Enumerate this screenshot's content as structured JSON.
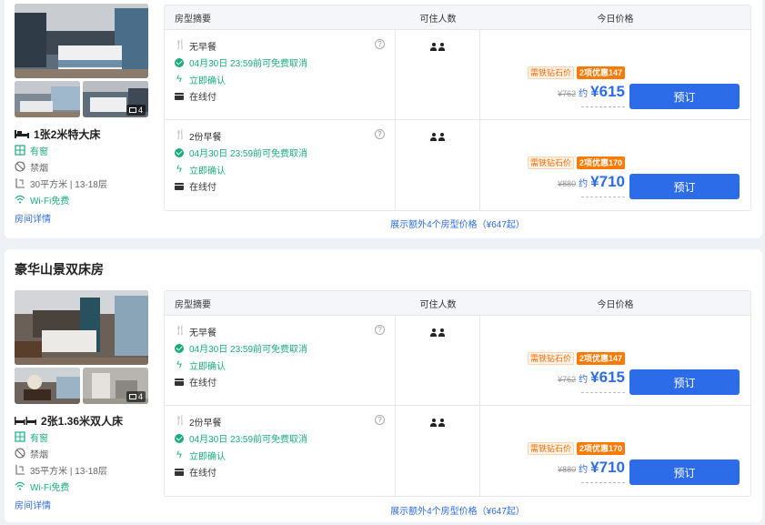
{
  "rooms": [
    {
      "title": "",
      "photo_count": "4",
      "bed": "1张2米特大床",
      "window": "有窗",
      "smoking": "禁烟",
      "area_floor": "30平方米 | 13-18层",
      "wifi": "Wi-Fi免费",
      "detail_link": "房间详情",
      "more_link": "展示额外4个房型价格（¥647起）",
      "offers": [
        {
          "meal": "无早餐",
          "cancel": "04月30日 23:59前可免费取消",
          "confirm": "立即确认",
          "pay": "在线付",
          "promo1": "需铁钻石价",
          "promo2": "2项优惠147",
          "old_price": "¥762",
          "about": "约",
          "price": "¥615",
          "book": "预订"
        },
        {
          "meal": "2份早餐",
          "cancel": "04月30日 23:59前可免费取消",
          "confirm": "立即确认",
          "pay": "在线付",
          "promo1": "需铁钻石价",
          "promo2": "2项优惠170",
          "old_price": "¥880",
          "about": "约",
          "price": "¥710",
          "book": "预订"
        }
      ]
    },
    {
      "title": "豪华山景双床房",
      "photo_count": "4",
      "bed": "2张1.36米双人床",
      "window": "有窗",
      "smoking": "禁烟",
      "area_floor": "35平方米 | 13-18层",
      "wifi": "Wi-Fi免费",
      "detail_link": "房间详情",
      "more_link": "展示额外4个房型价格（¥647起）",
      "offers": [
        {
          "meal": "无早餐",
          "cancel": "04月30日 23:59前可免费取消",
          "confirm": "立即确认",
          "pay": "在线付",
          "promo1": "需铁钻石价",
          "promo2": "2项优惠147",
          "old_price": "¥762",
          "about": "约",
          "price": "¥615",
          "book": "预订"
        },
        {
          "meal": "2份早餐",
          "cancel": "04月30日 23:59前可免费取消",
          "confirm": "立即确认",
          "pay": "在线付",
          "promo1": "需铁钻石价",
          "promo2": "2项优惠170",
          "old_price": "¥880",
          "about": "约",
          "price": "¥710",
          "book": "预订"
        }
      ]
    }
  ],
  "table_head": {
    "summary": "房型摘要",
    "guests": "可住人数",
    "price": "今日价格"
  },
  "colors": {
    "accent": "#2d6ce8",
    "green": "#1aad7b",
    "promo": "#ff7a00"
  }
}
